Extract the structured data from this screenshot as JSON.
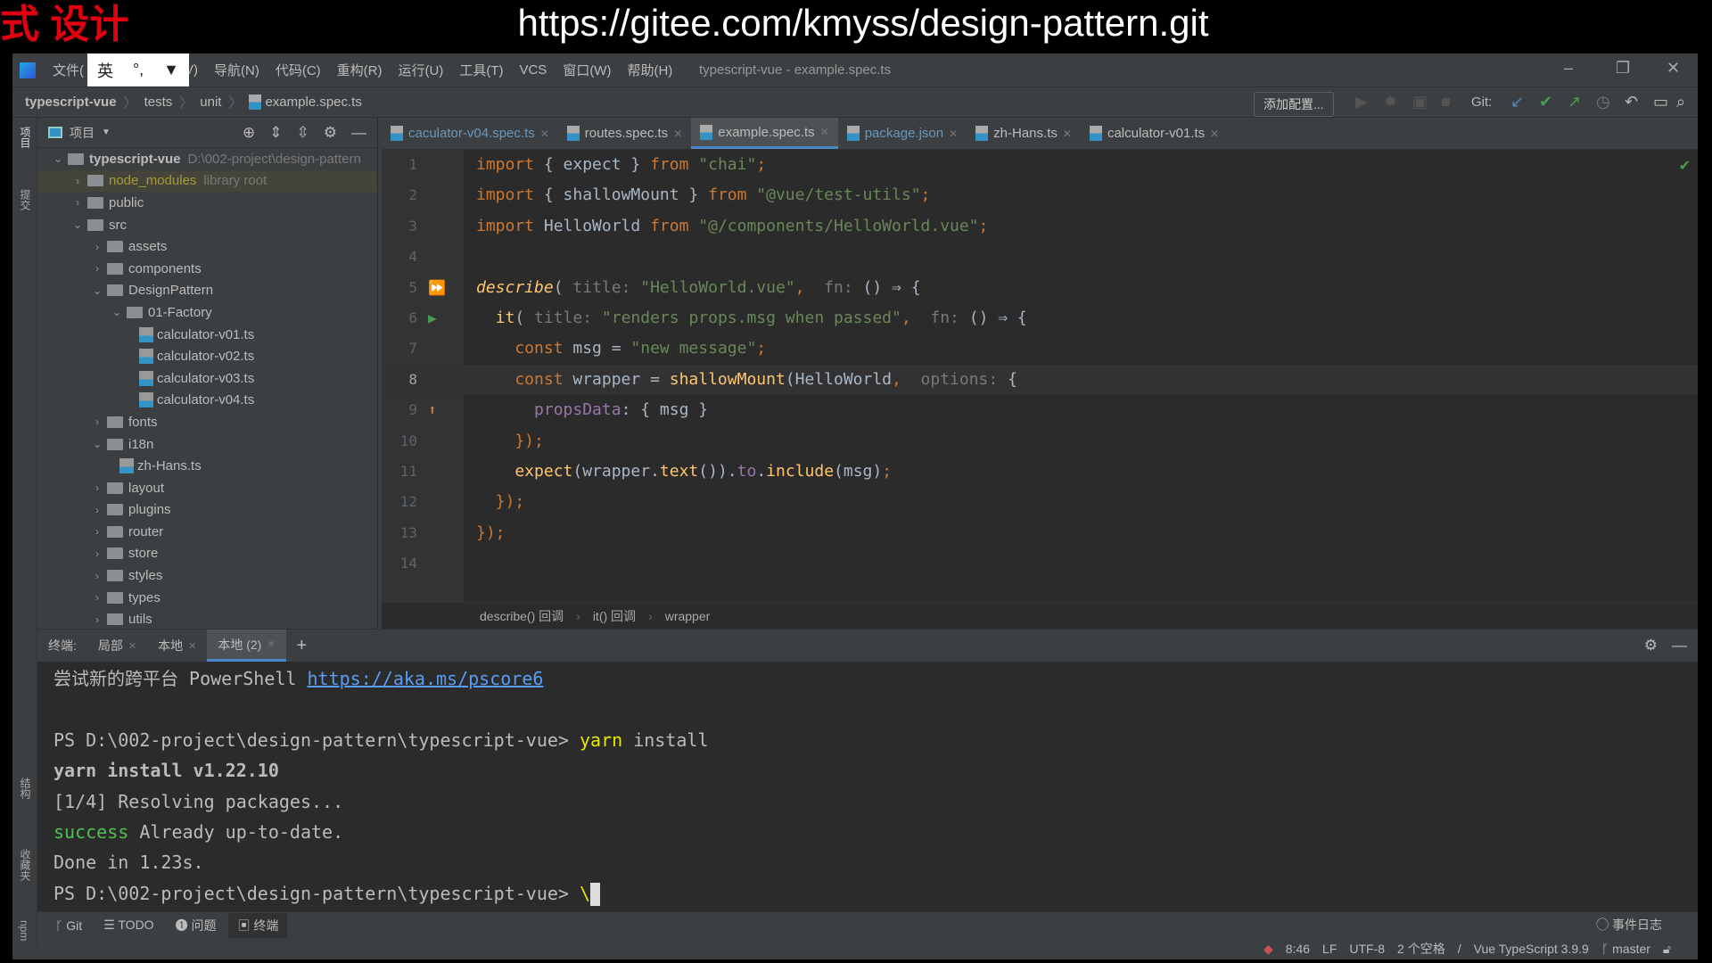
{
  "banner": {
    "left": "式 设计",
    "url": "https://gitee.com/kmyss/design-pattern.git"
  },
  "menu": {
    "items": [
      "文件(",
      "(V)",
      "导航(N)",
      "代码(C)",
      "重构(R)",
      "运行(U)",
      "工具(T)",
      "VCS",
      "窗口(W)",
      "帮助(H)"
    ],
    "ime": [
      "英",
      "°,",
      "👕"
    ],
    "title": "typescript-vue - example.spec.ts"
  },
  "nav": {
    "crumbs": [
      "typescript-vue",
      "tests",
      "unit",
      "example.spec.ts"
    ],
    "add_config": "添加配置...",
    "git_label": "Git:"
  },
  "side_labels": {
    "project": "项目",
    "commit": "提交",
    "structure": "结构",
    "favorites": "收藏夹",
    "npm": "npm"
  },
  "project": {
    "title": "项目",
    "tree": [
      {
        "label": "typescript-vue",
        "hint": "D:\\002-project\\design-pattern",
        "depth": 0,
        "type": "folder",
        "open": true,
        "bold": true
      },
      {
        "label": "node_modules",
        "hint": "library root",
        "depth": 1,
        "type": "folder",
        "open": false,
        "lib": true
      },
      {
        "label": "public",
        "depth": 1,
        "type": "folder",
        "open": false
      },
      {
        "label": "src",
        "depth": 1,
        "type": "folder",
        "open": true
      },
      {
        "label": "assets",
        "depth": 2,
        "type": "folder",
        "open": false
      },
      {
        "label": "components",
        "depth": 2,
        "type": "folder",
        "open": false
      },
      {
        "label": "DesignPattern",
        "depth": 2,
        "type": "folder",
        "open": true
      },
      {
        "label": "01-Factory",
        "depth": 3,
        "type": "folder",
        "open": true
      },
      {
        "label": "calculator-v01.ts",
        "depth": 4,
        "type": "ts"
      },
      {
        "label": "calculator-v02.ts",
        "depth": 4,
        "type": "ts"
      },
      {
        "label": "calculator-v03.ts",
        "depth": 4,
        "type": "ts"
      },
      {
        "label": "calculator-v04.ts",
        "depth": 4,
        "type": "ts"
      },
      {
        "label": "fonts",
        "depth": 2,
        "type": "folder",
        "open": false
      },
      {
        "label": "i18n",
        "depth": 2,
        "type": "folder",
        "open": true
      },
      {
        "label": "zh-Hans.ts",
        "depth": 3,
        "type": "ts"
      },
      {
        "label": "layout",
        "depth": 2,
        "type": "folder",
        "open": false
      },
      {
        "label": "plugins",
        "depth": 2,
        "type": "folder",
        "open": false
      },
      {
        "label": "router",
        "depth": 2,
        "type": "folder",
        "open": false
      },
      {
        "label": "store",
        "depth": 2,
        "type": "folder",
        "open": false
      },
      {
        "label": "styles",
        "depth": 2,
        "type": "folder",
        "open": false
      },
      {
        "label": "types",
        "depth": 2,
        "type": "folder",
        "open": false
      },
      {
        "label": "utils",
        "depth": 2,
        "type": "folder",
        "open": false
      }
    ]
  },
  "tabs": [
    {
      "label": "caculator-v04.spec.ts"
    },
    {
      "label": "routes.spec.ts"
    },
    {
      "label": "example.spec.ts",
      "active": true
    },
    {
      "label": "package.json"
    },
    {
      "label": "zh-Hans.ts"
    },
    {
      "label": "calculator-v01.ts"
    }
  ],
  "code": [
    [
      [
        "import ",
        "k"
      ],
      [
        "{ ",
        "v"
      ],
      [
        "expect",
        "v"
      ],
      [
        " } ",
        "v"
      ],
      [
        "from ",
        "k"
      ],
      [
        "\"chai\"",
        "s"
      ],
      [
        ";",
        "k"
      ]
    ],
    [
      [
        "import ",
        "k"
      ],
      [
        "{ ",
        "v"
      ],
      [
        "shallowMount",
        "v"
      ],
      [
        " } ",
        "v"
      ],
      [
        "from ",
        "k"
      ],
      [
        "\"@vue/test-utils\"",
        "s"
      ],
      [
        ";",
        "k"
      ]
    ],
    [
      [
        "import ",
        "k"
      ],
      [
        "HelloWorld ",
        "v"
      ],
      [
        "from ",
        "k"
      ],
      [
        "\"@/components/HelloWorld.vue\"",
        "s"
      ],
      [
        ";",
        "k"
      ]
    ],
    [],
    [
      [
        "describe",
        "it"
      ],
      [
        "( ",
        "v"
      ],
      [
        "title: ",
        "h"
      ],
      [
        "\"HelloWorld.vue\"",
        "s"
      ],
      [
        ", ",
        "k"
      ],
      [
        " fn: ",
        "h"
      ],
      [
        "() ⇒ {",
        "v"
      ]
    ],
    [
      [
        "  it",
        "g"
      ],
      [
        "( ",
        "v"
      ],
      [
        "title: ",
        "h"
      ],
      [
        "\"renders props.msg when passed\"",
        "s"
      ],
      [
        ", ",
        "k"
      ],
      [
        " fn: ",
        "h"
      ],
      [
        "() ⇒ {",
        "v"
      ]
    ],
    [
      [
        "    const ",
        "k"
      ],
      [
        "msg = ",
        "v"
      ],
      [
        "\"new message\"",
        "s"
      ],
      [
        ";",
        "k"
      ]
    ],
    [
      [
        "    const ",
        "k"
      ],
      [
        "wrapper = ",
        "v"
      ],
      [
        "shallowMount",
        "f"
      ],
      [
        "(HelloWorld",
        "v"
      ],
      [
        ", ",
        "k"
      ],
      [
        " options: ",
        "h"
      ],
      [
        "{",
        "v"
      ]
    ],
    [
      [
        "      propsData",
        "pr"
      ],
      [
        ": { msg }",
        "v"
      ]
    ],
    [
      [
        "    });",
        "k"
      ]
    ],
    [
      [
        "    expect",
        "f"
      ],
      [
        "(wrapper.",
        "v"
      ],
      [
        "text",
        "f"
      ],
      [
        "()).",
        "v"
      ],
      [
        "to",
        "pr"
      ],
      [
        ".",
        "v"
      ],
      [
        "include",
        "f"
      ],
      [
        "(msg)",
        "v"
      ],
      [
        ";",
        "k"
      ]
    ],
    [
      [
        "  });",
        "k"
      ]
    ],
    [
      [
        "});",
        "k"
      ]
    ],
    []
  ],
  "editor_crumbs": [
    "describe() 回调",
    "it() 回调",
    "wrapper"
  ],
  "terminal": {
    "label": "终端:",
    "tabs": [
      {
        "label": "局部"
      },
      {
        "label": "本地"
      },
      {
        "label": "本地 (2)",
        "active": true
      }
    ],
    "lines": [
      [
        [
          "尝试新的跨平台 PowerShell ",
          ""
        ],
        [
          "https://aka.ms/pscore6",
          "lnk"
        ]
      ],
      [],
      [
        [
          "PS D:\\002-project\\design-pattern\\typescript-vue> ",
          ""
        ],
        [
          "yarn",
          "ylw"
        ],
        [
          " install",
          ""
        ]
      ],
      [
        [
          "yarn install v1.22.10",
          "bold"
        ]
      ],
      [
        [
          "[1/4] Resolving packages...",
          ""
        ]
      ],
      [
        [
          "success",
          "succ"
        ],
        [
          " Already up-to-date.",
          ""
        ]
      ],
      [
        [
          "Done in 1.23s.",
          ""
        ]
      ],
      [
        [
          "PS D:\\002-project\\design-pattern\\typescript-vue> ",
          ""
        ],
        [
          "\\",
          "ylw"
        ]
      ]
    ]
  },
  "bottom_tools": [
    {
      "label": "Git",
      "icon": "branch-icon"
    },
    {
      "label": "TODO",
      "icon": "list-icon"
    },
    {
      "label": "问题",
      "icon": "info-icon"
    },
    {
      "label": "终端",
      "icon": "terminal-icon",
      "active": true
    }
  ],
  "event_log": "事件日志",
  "status": {
    "position": "8:46",
    "line_sep": "LF",
    "encoding": "UTF-8",
    "indent": "2 个空格",
    "language": "Vue TypeScript 3.9.9",
    "branch": "master"
  },
  "colors": {
    "accent": "#4a88c7",
    "bg": "#2b2b2b",
    "panel": "#3c3f41"
  }
}
